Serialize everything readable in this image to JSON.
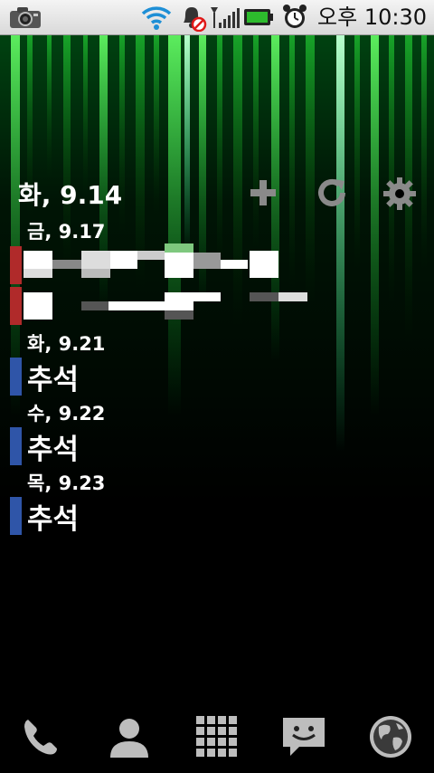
{
  "status_bar": {
    "time": "오후 10:30",
    "icons": [
      "camera-icon",
      "wifi-icon",
      "notification-muted-icon",
      "signal-icon",
      "battery-icon",
      "alarm-clock-icon"
    ]
  },
  "widget": {
    "today": "화, 9.14",
    "actions": [
      "add-icon",
      "refresh-icon",
      "settings-icon"
    ],
    "days": [
      {
        "date": "금, 9.17",
        "events": [
          {
            "title": "",
            "color": "#b02a2a"
          },
          {
            "title": "",
            "color": "#b02a2a"
          }
        ]
      },
      {
        "date": "화, 9.21",
        "events": [
          {
            "title": "추석",
            "color": "#2f55a8"
          }
        ]
      },
      {
        "date": "수, 9.22",
        "events": [
          {
            "title": "추석",
            "color": "#2f55a8"
          }
        ]
      },
      {
        "date": "목, 9.23",
        "events": [
          {
            "title": "추석",
            "color": "#2f55a8"
          }
        ]
      }
    ]
  },
  "dock": {
    "items": [
      "phone-icon",
      "contacts-icon",
      "app-drawer-icon",
      "messaging-icon",
      "browser-icon"
    ]
  },
  "colors": {
    "accent_green": "#33ff66",
    "event_red": "#b02a2a",
    "event_blue": "#2f55a8"
  }
}
